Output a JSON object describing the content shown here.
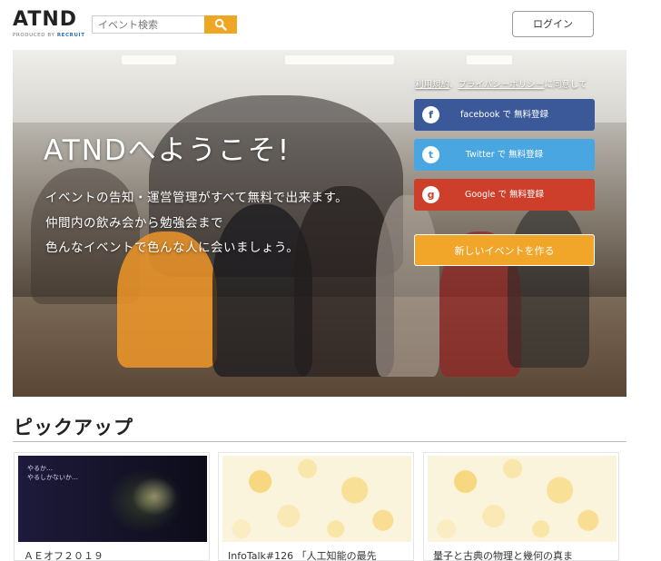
{
  "header": {
    "logo_text": "ATND",
    "logo_sub_prefix": "PRODUCED BY",
    "logo_sub_brand": "RECRUIT",
    "search_placeholder": "イベント検索",
    "search_icon": "search-icon",
    "login_label": "ログイン"
  },
  "hero": {
    "title": "ATNDへようこそ!",
    "lines": [
      "イベントの告知・運営管理がすべて無料で出来ます。",
      "仲間内の飲み会から勉強会まで",
      "色んなイベントで色んな人に会いましょう。"
    ],
    "agree_prefix": "利用規約",
    "agree_sep": "、",
    "agree_link": "プライバシーポリシー",
    "agree_suffix": "に同意して",
    "register": [
      {
        "label": "facebook で 無料登録",
        "icon": "facebook-icon",
        "glyph": "f",
        "color": "#3b5998"
      },
      {
        "label": "Twitter で 無料登録",
        "icon": "twitter-icon",
        "glyph": "t",
        "color": "#4aa6e0"
      },
      {
        "label": "Google で 無料登録",
        "icon": "google-icon",
        "glyph": "g",
        "color": "#cd3f2b"
      }
    ],
    "create_label": "新しいイベントを作る",
    "create_color": "#f1a529"
  },
  "pickup": {
    "title": "ピックアップ",
    "cards": [
      {
        "title": "ＡＥオフ２０１９",
        "thumb_text": [
          "やるか…",
          "やるしかないか…"
        ]
      },
      {
        "title": "InfoTalk#126 「人工知能の最先"
      },
      {
        "title": "量子と古典の物理と幾何の真ま"
      }
    ]
  }
}
